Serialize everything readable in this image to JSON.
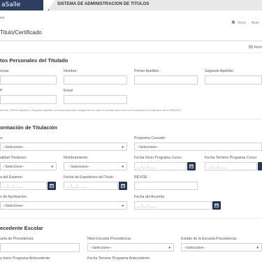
{
  "header": {
    "logo_text": "aSalle",
    "system_title": "SISTEMA DE ADMINISTRACION DE TITULOS",
    "crumb_left": "ión",
    "crumb_home": "Inicio",
    "crumb_current": "Alum",
    "page_title": "Titulo/Certificado",
    "search_label": "Alum"
  },
  "personal": {
    "title": "tos Personales del Titulado",
    "labels": {
      "matricula": "ricula",
      "nombre": "Nombre:",
      "primer_apellido": "Primer Apellido:",
      "segundo_apellido": "Segundo Apellido:",
      "curp": "P",
      "email": "Email"
    },
    "note": "lombre, Primer Apellido y Segundo Apellido no llevan acentos. Asegurese de usar el nombre tal y como se encuentra en el apellido de la RENAPO"
  },
  "titulacion": {
    "title": "ormación de Titulación",
    "labels": {
      "carrera": "a:",
      "programa_cursado": "Programa Cursado:",
      "modalidad": "alidad Titulacion:",
      "nombramiento": "Nombramiento:",
      "fecha_inicio": "Fecha Inicio Programa Curso:",
      "fecha_termino": "Fecha Termino Programa Curso:",
      "fecha_examen": "a del Examen:",
      "fecha_expedicion": "Fecha de Expedicion del Titulo:",
      "revoe": "REVOE:",
      "aprobacion": "o de Aprobación:",
      "fecha_acuerdo": "Fecha del Acuerdo:"
    },
    "select_placeholder": "--Seleccione--",
    "date_placeholder": "__/__/____"
  },
  "antecedente": {
    "title": "ecedente Escolar",
    "labels": {
      "escuela": "uela de Procedencia:",
      "nivel": "Nivel Escuela Procedencia:",
      "estado": "Estado de la Escuela Procedencia:",
      "fecha_inicio": "a Inicio Programa Antecedente:",
      "fecha_termino": "Fecha Termino Programa Antecedente:"
    }
  },
  "colors": {
    "topbar": "#2c3f63",
    "calendar_button": "#23365a",
    "border": "#cfcfcf"
  },
  "icons": [
    "home-icon",
    "search-icon",
    "calendar-icon",
    "chevron-down-icon"
  ]
}
